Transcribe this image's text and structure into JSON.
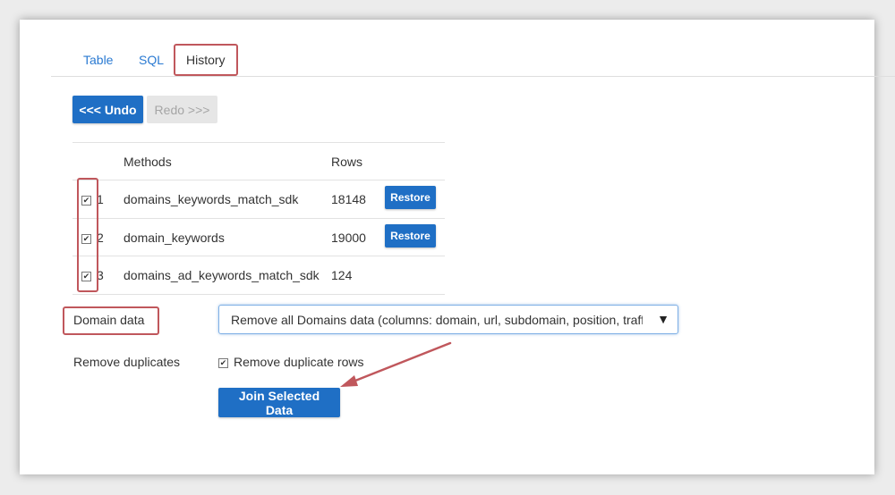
{
  "tabs": [
    {
      "label": "Table"
    },
    {
      "label": "SQL"
    },
    {
      "label": "History",
      "active": true
    }
  ],
  "toolbar": {
    "undo_label": "<<< Undo",
    "redo_label": "Redo >>>"
  },
  "history_table": {
    "headers": {
      "methods": "Methods",
      "rows": "Rows"
    },
    "rows": [
      {
        "index": "1",
        "method": "domains_keywords_match_sdk",
        "rows": "18148",
        "checked": true,
        "action": "Restore"
      },
      {
        "index": "2",
        "method": "domain_keywords",
        "rows": "19000",
        "checked": true,
        "action": "Restore"
      },
      {
        "index": "3",
        "method": "domains_ad_keywords_match_sdk",
        "rows": "124",
        "checked": true,
        "action": ""
      }
    ]
  },
  "domain_data": {
    "label": "Domain data",
    "selected": "Remove all Domains data (columns: domain, url, subdomain, position, traff, cpc, ...)"
  },
  "remove_duplicates": {
    "label": "Remove duplicates",
    "checkbox_label": "Remove duplicate rows",
    "checked": true
  },
  "join_button_label": "Join Selected Data",
  "colors": {
    "primary": "#1f6fc5",
    "link": "#2a7ad2",
    "annotation": "#c0575c"
  }
}
